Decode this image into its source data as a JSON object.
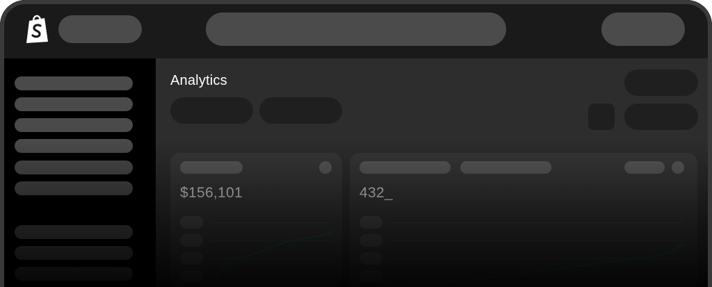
{
  "app": {
    "brand_icon": "shopify-bag-icon",
    "colors": {
      "frame": "#1a1a1a",
      "sidebar": "#000000",
      "main": "#2d2d2d",
      "card": "#383838",
      "chart_line": "#1f5c3f"
    }
  },
  "main": {
    "title": "Analytics"
  },
  "cards": [
    {
      "metric": "$156,101"
    },
    {
      "metric": "432_"
    }
  ]
}
